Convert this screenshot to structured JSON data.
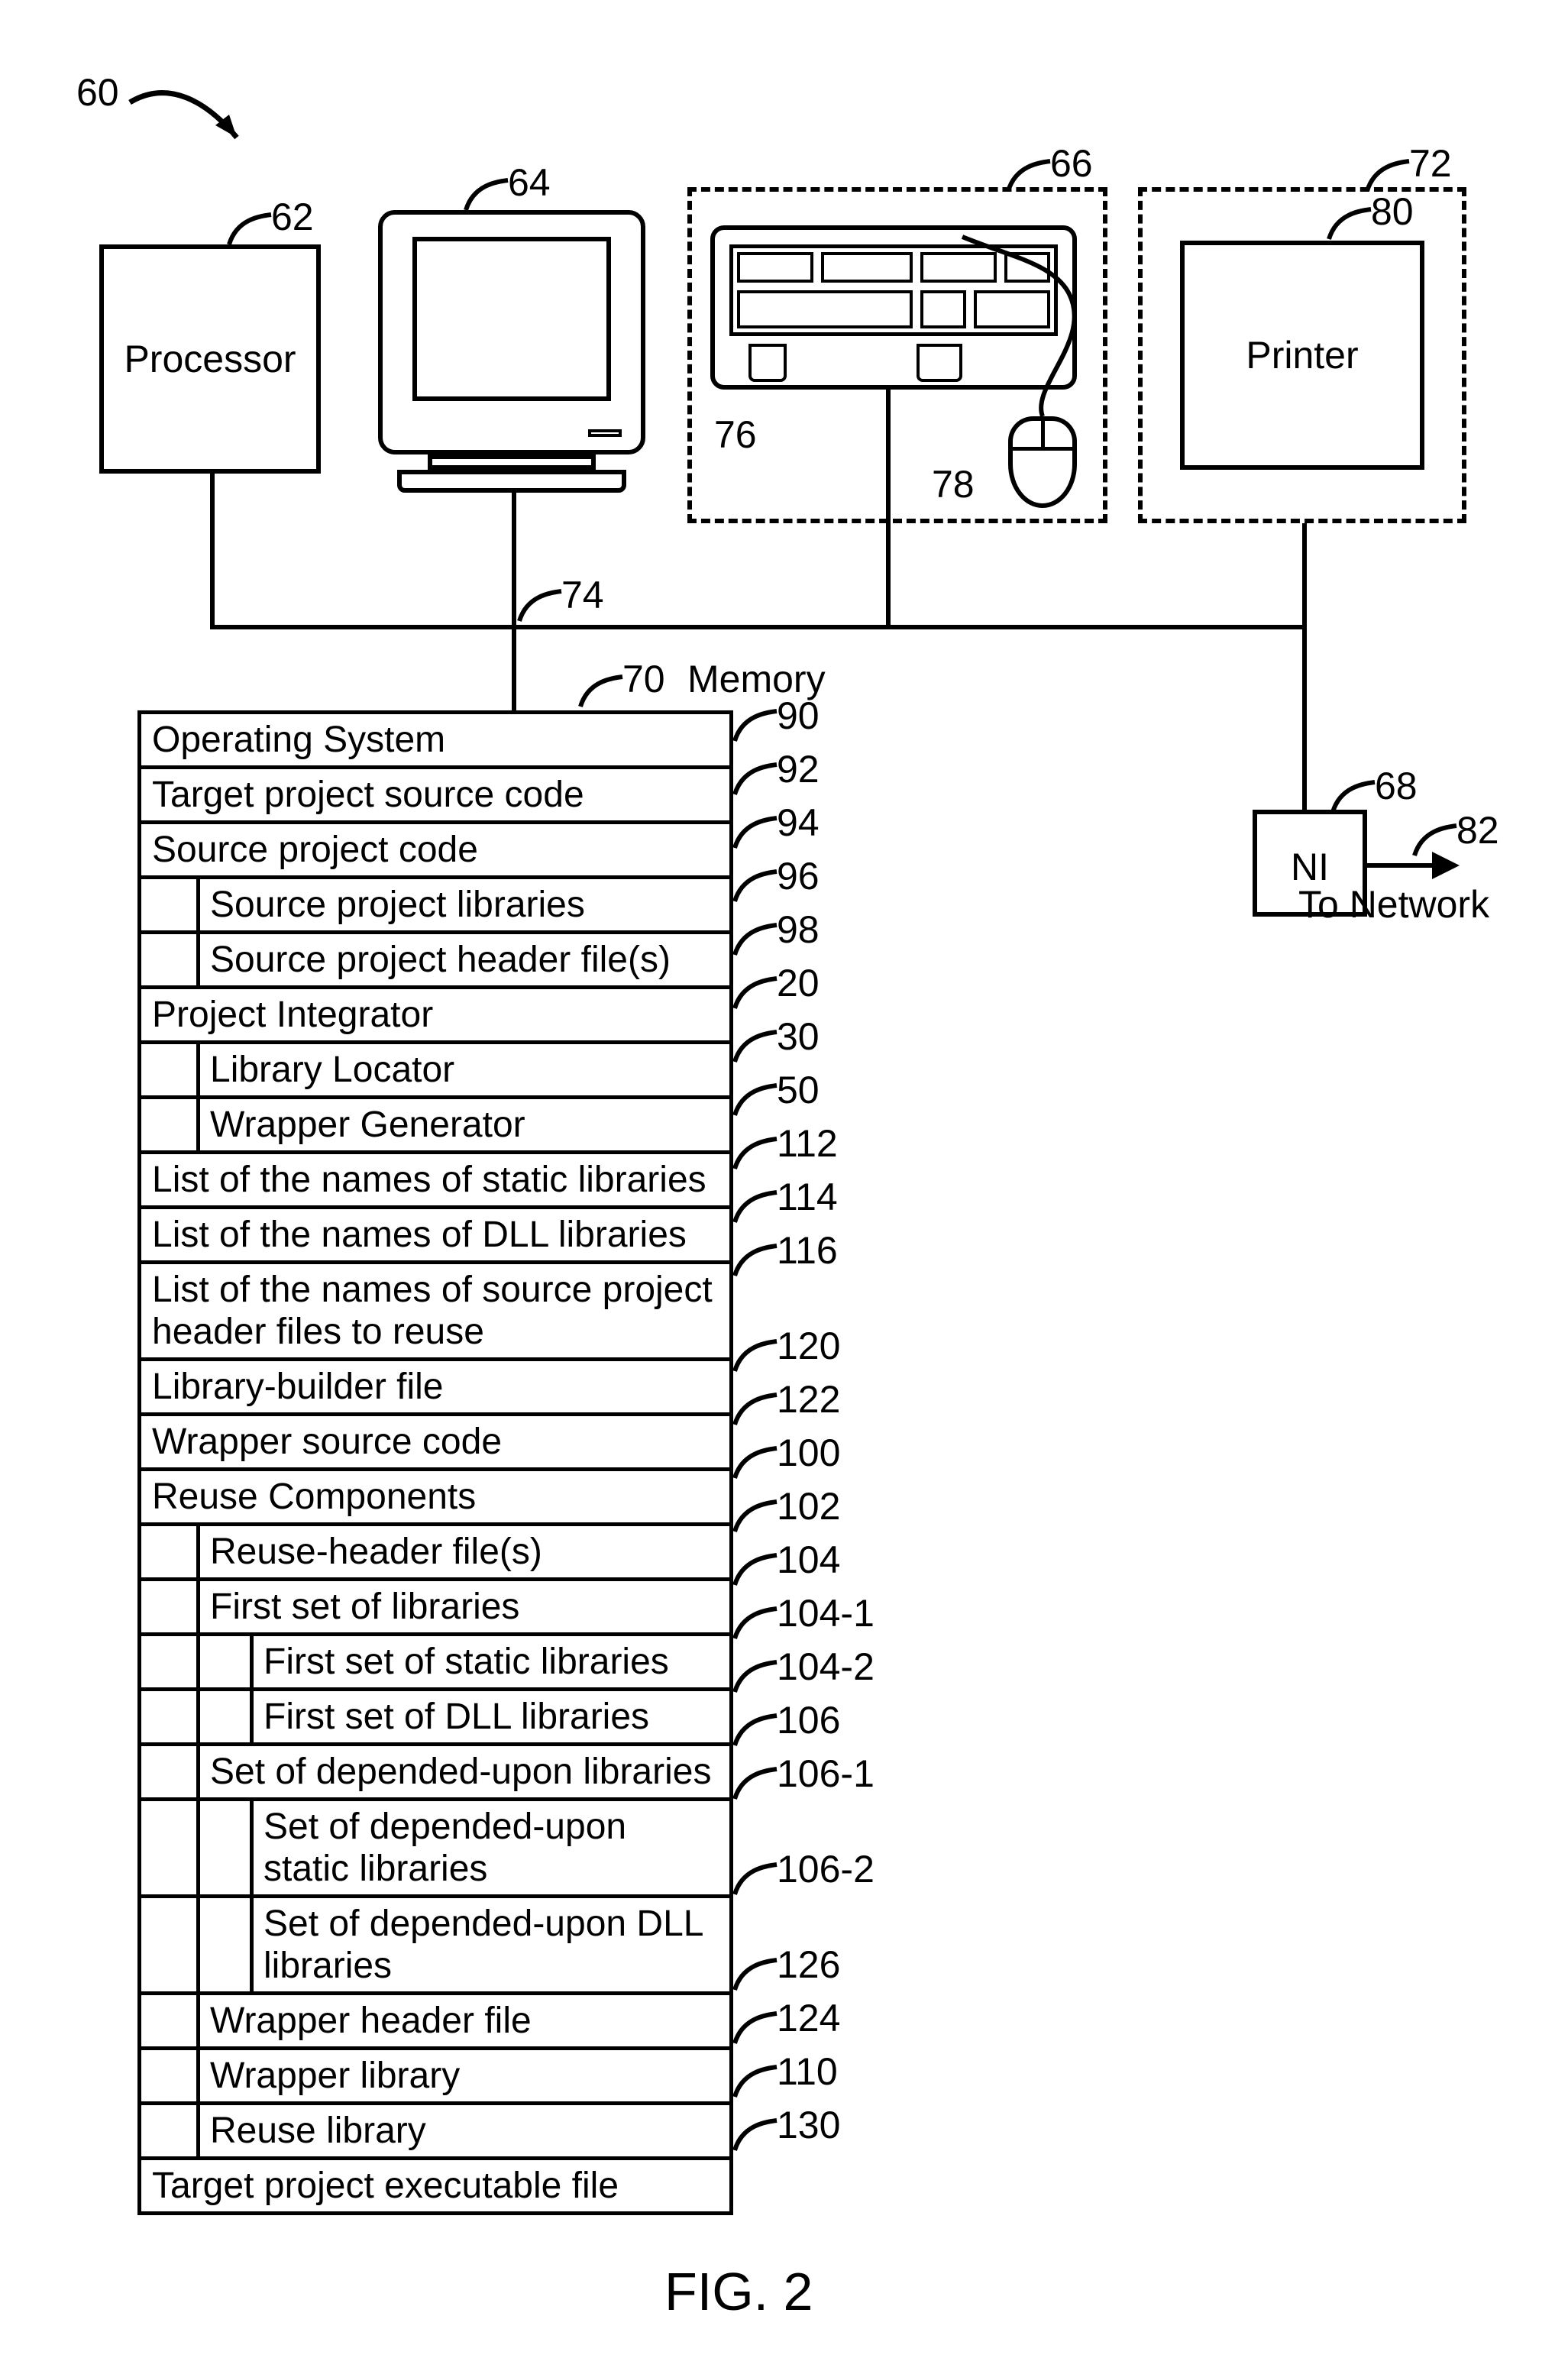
{
  "figure": {
    "label": "FIG. 2",
    "system_ref": "60"
  },
  "top": {
    "processor": {
      "label": "Processor",
      "ref": "62"
    },
    "monitor": {
      "ref": "64"
    },
    "input_group": {
      "ref": "66",
      "keyboard_ref": "76",
      "mouse_ref": "78"
    },
    "output_group": {
      "ref": "72",
      "printer_label": "Printer",
      "printer_ref": "80"
    }
  },
  "bus": {
    "ref": "74"
  },
  "memory": {
    "title": "Memory",
    "ref": "70",
    "rows": {
      "os": {
        "label": "Operating System",
        "ref": "90"
      },
      "tgt_src": {
        "label": "Target project source code",
        "ref": "92"
      },
      "src_code": {
        "label": "Source project code",
        "ref": "94"
      },
      "src_libs": {
        "label": "Source project libraries",
        "ref": "96"
      },
      "src_hdr": {
        "label": "Source project header file(s)",
        "ref": "98"
      },
      "pint": {
        "label": "Project Integrator",
        "ref": "20"
      },
      "libloc": {
        "label": "Library Locator",
        "ref": "30"
      },
      "wrapgen": {
        "label": "Wrapper Generator",
        "ref": "50"
      },
      "list_static": {
        "label": "List of the names of static libraries",
        "ref": "112"
      },
      "list_dll": {
        "label": "List of the names of DLL libraries",
        "ref": "114"
      },
      "list_hdr": {
        "label": "List of the names of source project header files to reuse",
        "ref": "116"
      },
      "libbld": {
        "label": "Library-builder file",
        "ref": "120"
      },
      "wrapsrc": {
        "label": "Wrapper source code",
        "ref": "122"
      },
      "reuse": {
        "label": "Reuse Components",
        "ref": "100"
      },
      "reuse_hdr": {
        "label": "Reuse-header file(s)",
        "ref": "102"
      },
      "first_set": {
        "label": "First set of libraries",
        "ref": "104"
      },
      "first_static": {
        "label": "First set of static libraries",
        "ref": "104-1"
      },
      "first_dll": {
        "label": "First set of DLL libraries",
        "ref": "104-2"
      },
      "dep_set": {
        "label": "Set of depended-upon libraries",
        "ref": "106"
      },
      "dep_static": {
        "label": "Set of depended-upon static libraries",
        "ref": "106-1"
      },
      "dep_dll": {
        "label": "Set of depended-upon DLL libraries",
        "ref": "106-2"
      },
      "wrap_hdr": {
        "label": "Wrapper header file",
        "ref": "126"
      },
      "wrap_lib": {
        "label": "Wrapper library",
        "ref": "124"
      },
      "reuse_lib": {
        "label": "Reuse library",
        "ref": "110"
      },
      "exe": {
        "label": "Target project executable file",
        "ref": "130"
      }
    }
  },
  "ni": {
    "label": "NI",
    "ref": "68",
    "net_ref": "82",
    "net_label": "To Network"
  }
}
